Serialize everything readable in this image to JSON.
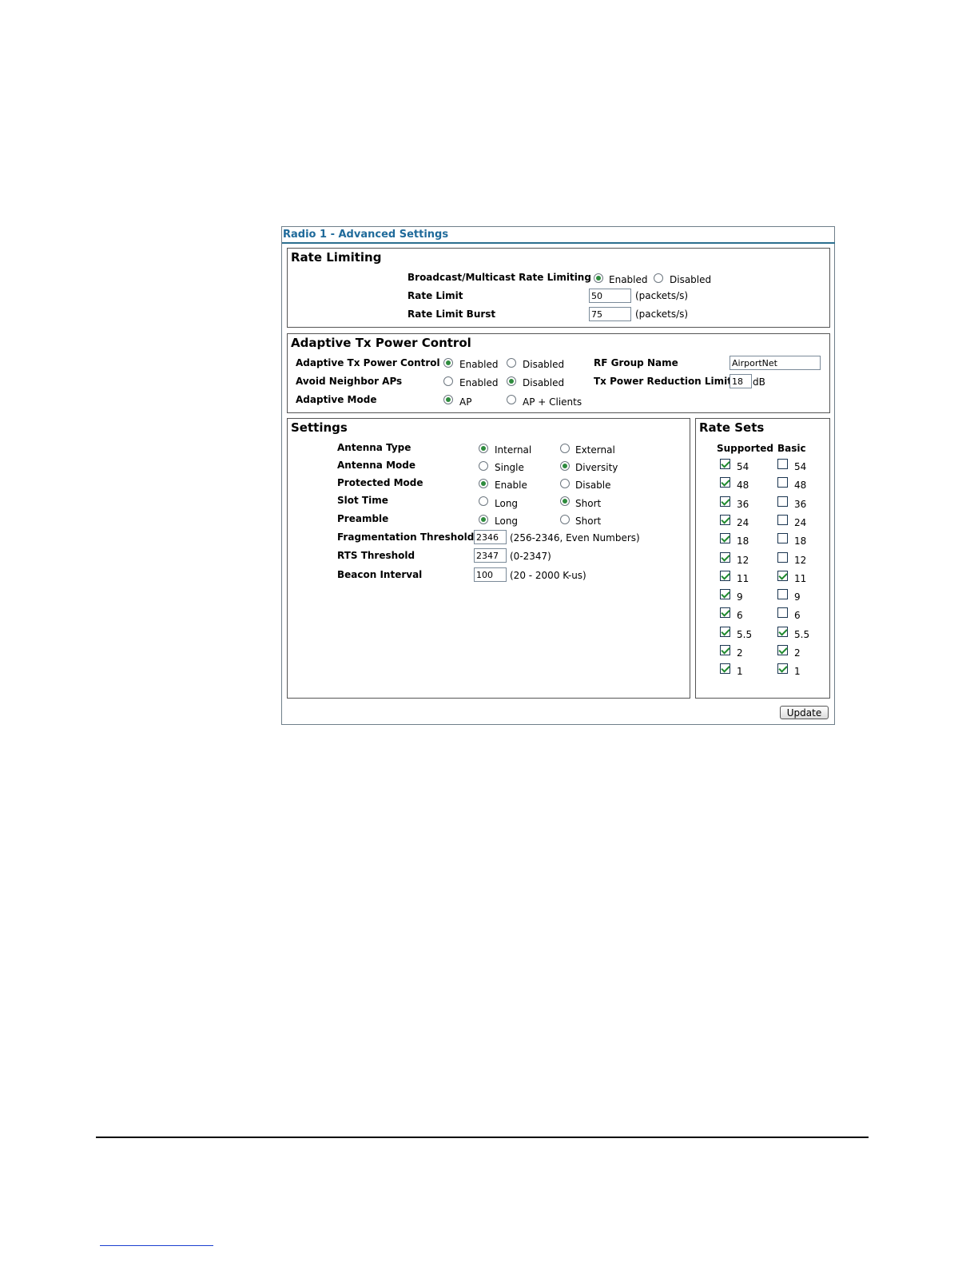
{
  "panel": {
    "title": "Radio 1 - Advanced Settings"
  },
  "rate_limiting": {
    "title": "Rate Limiting",
    "bcast_label": "Broadcast/Multicast Rate Limiting",
    "enabled": "Enabled",
    "disabled": "Disabled",
    "rate_limit_label": "Rate Limit",
    "rate_limit_value": "50",
    "rate_limit_unit": "(packets/s)",
    "burst_label": "Rate Limit Burst",
    "burst_value": "75",
    "burst_unit": "(packets/s)"
  },
  "atpc": {
    "title": "Adaptive Tx Power Control",
    "atpc_label": "Adaptive Tx Power Control",
    "avoid_label": "Avoid Neighbor APs",
    "mode_label": "Adaptive Mode",
    "enabled": "Enabled",
    "disabled": "Disabled",
    "ap": "AP",
    "ap_clients": "AP + Clients",
    "rf_group_label": "RF Group Name",
    "rf_group_value": "AirportNet",
    "reduction_label": "Tx Power Reduction Limit",
    "reduction_value": "18",
    "reduction_unit": "dB"
  },
  "settings": {
    "title": "Settings",
    "antenna_type_label": "Antenna Type",
    "internal": "Internal",
    "external": "External",
    "antenna_mode_label": "Antenna Mode",
    "single": "Single",
    "diversity": "Diversity",
    "protected_label": "Protected Mode",
    "enable": "Enable",
    "disable": "Disable",
    "slot_label": "Slot Time",
    "preamble_label": "Preamble",
    "long": "Long",
    "short": "Short",
    "frag_label": "Fragmentation Threshold",
    "frag_value": "2346",
    "frag_hint": "(256-2346, Even Numbers)",
    "rts_label": "RTS Threshold",
    "rts_value": "2347",
    "rts_hint": "(0-2347)",
    "beacon_label": "Beacon Interval",
    "beacon_value": "100",
    "beacon_hint": "(20 - 2000 K-us)"
  },
  "rate_sets": {
    "title": "Rate Sets",
    "supported_header": "Supported",
    "basic_header": "Basic",
    "rates": [
      "54",
      "48",
      "36",
      "24",
      "18",
      "12",
      "11",
      "9",
      "6",
      "5.5",
      "2",
      "1"
    ],
    "supported": [
      true,
      true,
      true,
      true,
      true,
      true,
      true,
      true,
      true,
      true,
      true,
      true
    ],
    "basic": [
      false,
      false,
      false,
      false,
      false,
      false,
      true,
      false,
      false,
      true,
      true,
      true
    ]
  },
  "update_label": "Update"
}
